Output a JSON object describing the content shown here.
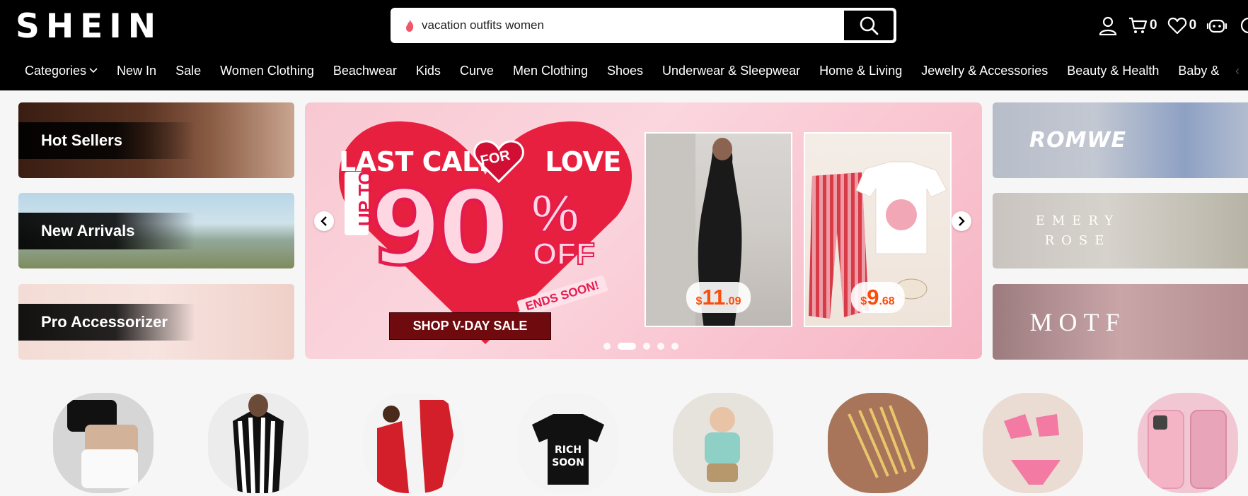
{
  "header": {
    "logo": "SHEIN",
    "search": {
      "value": "vacation outfits women"
    },
    "cart_count": "0",
    "wishlist_count": "0"
  },
  "nav": {
    "items": [
      "Categories",
      "New In",
      "Sale",
      "Women Clothing",
      "Beachwear",
      "Kids",
      "Curve",
      "Men Clothing",
      "Shoes",
      "Underwear & Sleepwear",
      "Home & Living",
      "Jewelry & Accessories",
      "Beauty & Health",
      "Baby &"
    ]
  },
  "promos": [
    {
      "label": "Hot Sellers"
    },
    {
      "label": "New Arrivals"
    },
    {
      "label": "Pro Accessorizer"
    }
  ],
  "banner": {
    "headline_left": "LAST CALL",
    "headline_badge": "FOR",
    "headline_right": "LOVE",
    "up_to": "UP TO",
    "discount": "90",
    "percent": "%",
    "off": "OFF",
    "ends": "ENDS SOON!",
    "cta": "SHOP V-DAY SALE",
    "products": [
      {
        "currency": "$",
        "price_int": "11",
        "price_dec": ".09"
      },
      {
        "currency": "$",
        "price_int": "9",
        "price_dec": ".68"
      }
    ],
    "slide_count": 5,
    "active_slide": 2
  },
  "brands": [
    {
      "name": "ROMWE"
    },
    {
      "name": "EMERY ROSE"
    },
    {
      "name": "MOTF"
    }
  ],
  "colors": {
    "header_bg": "#000000",
    "accent_red": "#e61b4d",
    "price_orange": "#fa4d0b",
    "cta_bg": "#6f0a0f"
  }
}
